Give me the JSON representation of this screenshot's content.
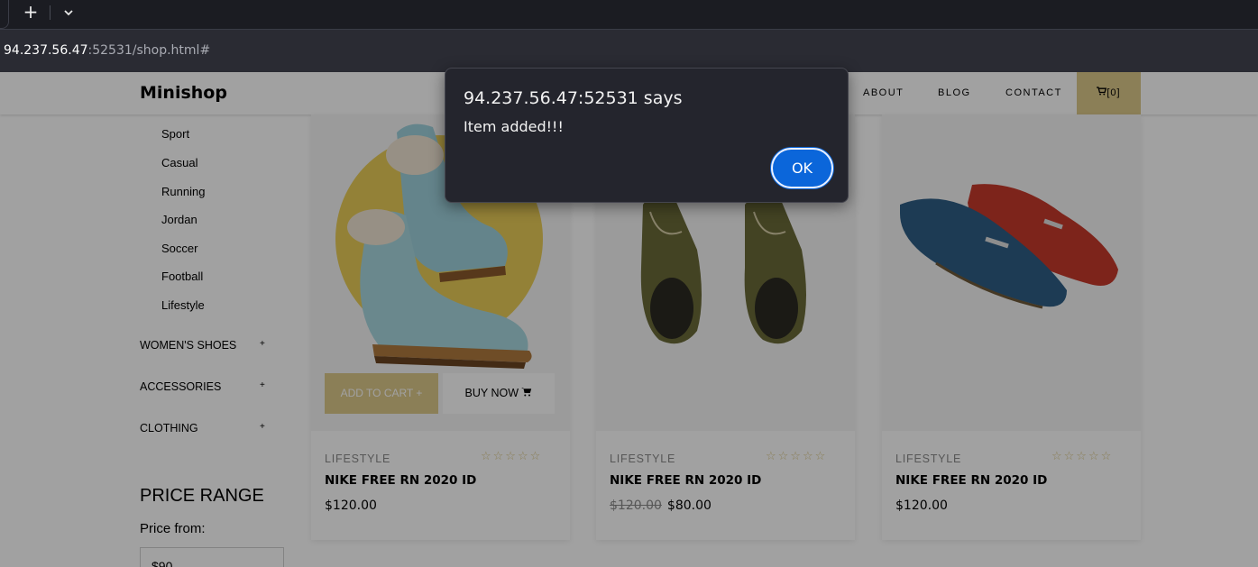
{
  "browser": {
    "new_tab_label": "+",
    "url_host": "94.237.56.47",
    "url_rest": ":52531/shop.html#"
  },
  "site": {
    "brand": "Minishop",
    "nav": {
      "about": "ABOUT",
      "blog": "BLOG",
      "contact": "CONTACT",
      "cart": "[0]"
    }
  },
  "sidebar": {
    "categories": [
      "Sport",
      "Casual",
      "Running",
      "Jordan",
      "Soccer",
      "Football",
      "Lifestyle"
    ],
    "sections": [
      "WOMEN'S SHOES",
      "ACCESSORIES",
      "CLOTHING"
    ],
    "expand_symbol": "+",
    "price_range_title": "PRICE RANGE",
    "price_from_label": "Price from:",
    "price_from_value": "$90"
  },
  "products": [
    {
      "category": "LIFESTYLE",
      "name": "NIKE FREE RN 2020 ID",
      "price": "$120.00",
      "old_price": "",
      "stars": "☆☆☆☆☆"
    },
    {
      "category": "LIFESTYLE",
      "name": "NIKE FREE RN 2020 ID",
      "price": "$80.00",
      "old_price": "$120.00",
      "stars": "☆☆☆☆☆"
    },
    {
      "category": "LIFESTYLE",
      "name": "NIKE FREE RN 2020 ID",
      "price": "$120.00",
      "old_price": "",
      "stars": "☆☆☆☆☆"
    }
  ],
  "card_actions": {
    "add_to_cart": "ADD TO CART",
    "buy_now": "BUY NOW"
  },
  "dialog": {
    "title": "94.237.56.47:52531 says",
    "message": "Item added!!!",
    "ok_label": "OK"
  },
  "colors": {
    "accent": "#dcc98a",
    "dialog_bg": "#24252d",
    "ok_button": "#0b66da"
  }
}
